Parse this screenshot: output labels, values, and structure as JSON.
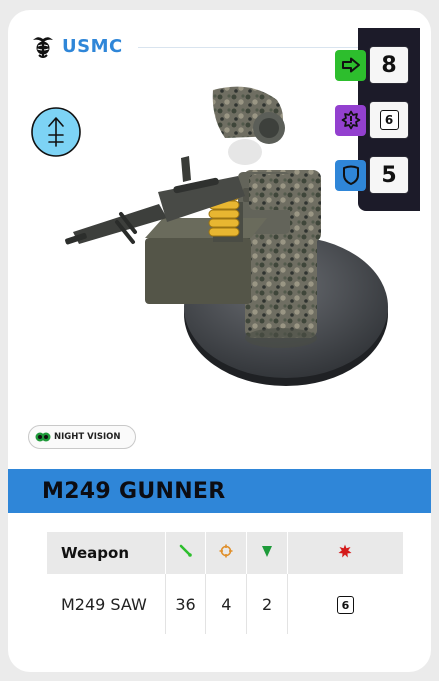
{
  "faction": {
    "name": "USMC",
    "emblem_icon": "eagle-globe-anchor-icon"
  },
  "unit": {
    "title": "M249 GUNNER",
    "symbol_icon": "support-weapon-symbol-icon",
    "figure_icon": "soldier-miniature-with-machine-gun"
  },
  "stats": {
    "move": {
      "icon": "arrow-right-icon",
      "value": "8",
      "color": "#2dbe2d"
    },
    "morale": {
      "icon": "starburst-alert-icon",
      "value": "6",
      "color": "#9340cf",
      "is_die": true
    },
    "defense": {
      "icon": "shield-icon",
      "value": "5",
      "color": "#2f86d8"
    }
  },
  "abilities": [
    {
      "label": "NIGHT VISION",
      "icon": "night-vision-goggles-icon",
      "color": "#1f9a3a"
    }
  ],
  "weapons_table": {
    "headers": {
      "weapon": "Weapon",
      "range_icon": "range-icon",
      "aim_icon": "crosshair-icon",
      "damage_icon": "damage-drop-icon",
      "critical_icon": "critical-burst-icon"
    },
    "rows": [
      {
        "name": "M249 SAW",
        "range": "36",
        "aim": "4",
        "damage": "2",
        "critical": "6"
      }
    ]
  },
  "colors": {
    "accent": "#2f86d8",
    "stats_panel": "#1c1b29",
    "range": "#2dbe2d",
    "aim": "#e0902c",
    "damage": "#1e9b3a",
    "critical": "#d41a1a"
  }
}
